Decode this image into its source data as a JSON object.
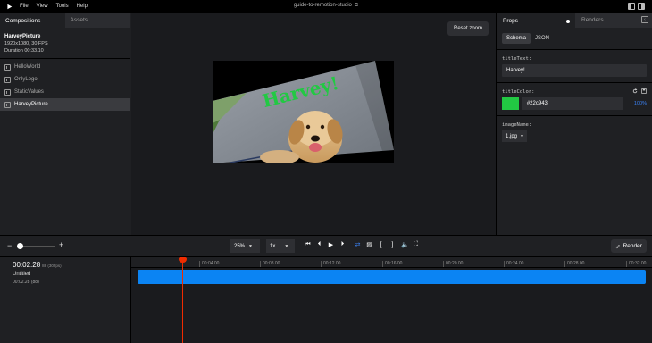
{
  "menu": {
    "items": [
      "File",
      "View",
      "Tools",
      "Help"
    ],
    "title": "guide-to-remotion-studio"
  },
  "left_panel": {
    "tabs": [
      "Compositions",
      "Assets"
    ],
    "composition": {
      "name": "HarveyPicture",
      "resolution": "1920x1080, 30 FPS",
      "duration": "Duration 00:33.10"
    },
    "items": [
      "HelloWorld",
      "OnlyLogo",
      "StaticValues",
      "HarveyPicture"
    ],
    "selected": "HarveyPicture"
  },
  "canvas": {
    "reset_zoom": "Reset zoom",
    "preview_text": "Harvey!",
    "preview_text_color": "#22c943"
  },
  "right_panel": {
    "tabs": [
      "Props",
      "Renders"
    ],
    "schema_options": [
      "Schema",
      "JSON"
    ],
    "fields": {
      "title_text_label": "titleText:",
      "title_text_value": "Harvey!",
      "title_color_label": "titleColor:",
      "title_color_value": "#22c943",
      "title_color_opacity": "100%",
      "image_name_label": "imageName:",
      "image_name_value": "1.jpg"
    }
  },
  "controls": {
    "zoom_level": "25%",
    "playback_rate": "1x",
    "render_label": "Render"
  },
  "timeline": {
    "timecode": "00:02.28",
    "timecode_frames": "88 (30 fps)",
    "track_name": "Untitled",
    "track_time": "00:02.28 (88)",
    "ticks": [
      "00:04.00",
      "00:08.00",
      "00:12.00",
      "00:16.00",
      "00:20.00",
      "00:24.00",
      "00:28.00",
      "00:32.00"
    ]
  },
  "colors": {
    "accent": "#0b84f3",
    "playhead": "#f02c00",
    "swatch": "#22c943"
  }
}
